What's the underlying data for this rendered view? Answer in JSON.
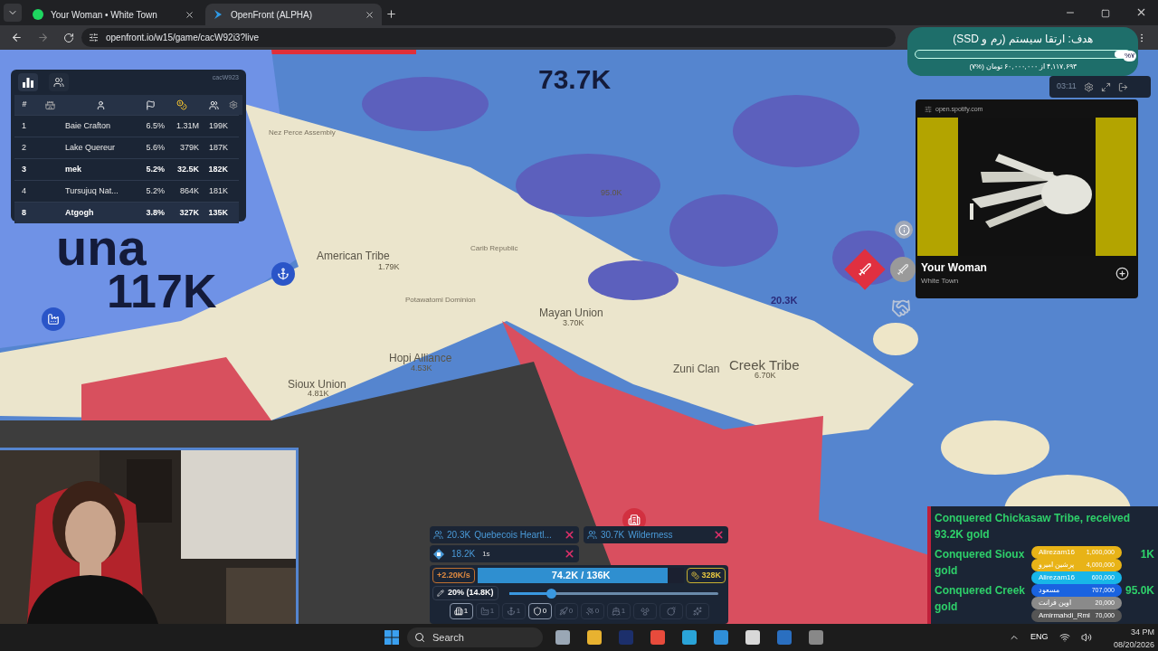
{
  "browser": {
    "tabs": [
      {
        "title": "Your Woman • White Town",
        "kind": "music",
        "selected": false
      },
      {
        "title": "OpenFront (ALPHA)",
        "kind": "game",
        "selected": true
      }
    ],
    "url": "openfront.io/w15/game/cacW92i3?live"
  },
  "leaderboard": {
    "game_id": "cacW923",
    "rank_header": "#",
    "rows": [
      {
        "rank": "1",
        "name": "Baie Crafton",
        "land": "6.5%",
        "gold": "1.31M",
        "troops": "199K",
        "highlighted": false
      },
      {
        "rank": "2",
        "name": "Lake Quereur",
        "land": "5.6%",
        "gold": "379K",
        "troops": "187K",
        "highlighted": false
      },
      {
        "rank": "3",
        "name": "mek",
        "land": "5.2%",
        "gold": "32.5K",
        "troops": "182K",
        "highlighted": true
      },
      {
        "rank": "4",
        "name": "Tursujuq Nat...",
        "land": "5.2%",
        "gold": "864K",
        "troops": "181K",
        "highlighted": false
      },
      {
        "rank": "8",
        "name": "Atgogh",
        "land": "3.8%",
        "gold": "327K",
        "troops": "135K",
        "highlighted": true
      }
    ]
  },
  "map": {
    "labels": [
      {
        "text": "73.7K",
        "kind": "power"
      },
      {
        "text": "una",
        "kind": "power"
      },
      {
        "text": "117K",
        "kind": "power"
      },
      {
        "text": "Nez Perce Assembly",
        "kind": "minor"
      },
      {
        "text": "American Tribe",
        "kind": "region"
      },
      {
        "text": "1.79K",
        "kind": "value"
      },
      {
        "text": "Carib Republic",
        "kind": "minor"
      },
      {
        "text": "Potawatomi Dominion",
        "kind": "minor"
      },
      {
        "text": "95.0K",
        "kind": "value"
      },
      {
        "text": "Mayan Union",
        "kind": "region"
      },
      {
        "text": "3.70K",
        "kind": "value"
      },
      {
        "text": "20.3K",
        "kind": "enemy"
      },
      {
        "text": "Hopi Alliance",
        "kind": "region"
      },
      {
        "text": "4.53K",
        "kind": "value"
      },
      {
        "text": "Sioux Union",
        "kind": "region"
      },
      {
        "text": "4.81K",
        "kind": "value"
      },
      {
        "text": "Zuni Clan",
        "kind": "region"
      },
      {
        "text": "Creek Tribe",
        "kind": "large"
      },
      {
        "text": "6.70K",
        "kind": "value"
      }
    ]
  },
  "goal": {
    "title": "هدف: ارتقا سیستم (رم و SSD)",
    "percent": "%۷",
    "level": 0.07,
    "summary": "۴,۱۱۷,۶۹۳ از ۶۰,۰۰۰,۰۰۰ تومان (%۷)"
  },
  "timer": "03:11",
  "now_playing": {
    "source": "open.spotify.com",
    "track": "Your Woman",
    "artist": "White Town"
  },
  "attacks": [
    {
      "troops": "20.3K",
      "target": "Quebecois Heartl..."
    },
    {
      "troops": "30.7K",
      "target": "Wilderness"
    }
  ],
  "boat": {
    "troops": "18.2K",
    "time": "1s"
  },
  "troop_bar": {
    "rate": "+2.20K/s",
    "text": "74.2K / 136K",
    "level": 0.92,
    "gold": "328K"
  },
  "attack_ratio": {
    "text": "20% (14.8K)",
    "level": 0.2
  },
  "builds": [
    {
      "kind": "city",
      "count": "1",
      "selected": true
    },
    {
      "kind": "factory",
      "count": "1",
      "selected": false
    },
    {
      "kind": "port",
      "count": "1",
      "selected": false
    },
    {
      "kind": "defense",
      "count": "0",
      "selected": true
    },
    {
      "kind": "missile",
      "count": "0",
      "selected": false
    },
    {
      "kind": "sam",
      "count": "0",
      "selected": false
    },
    {
      "kind": "warship",
      "count": "1",
      "selected": false
    },
    {
      "kind": "atom",
      "selected": false
    },
    {
      "kind": "hydrogen",
      "selected": false
    },
    {
      "kind": "mirv",
      "selected": false
    }
  ],
  "messages": [
    {
      "text": "Conquered Chickasaw Tribe, received 93.2K gold"
    },
    {
      "text": "Conquered Sioux",
      "tail": "1K",
      "end": "gold"
    },
    {
      "text": "Conquered Creek",
      "tail": "95.0K",
      "end": "gold"
    }
  ],
  "donors": [
    {
      "name": "Alirezam16",
      "amount": "1,000,000",
      "color": "#e8b317"
    },
    {
      "name": "پرشین امیرو",
      "amount": "4,000,000",
      "color": "#e8b317"
    },
    {
      "name": "Alirezam16",
      "amount": "600,000",
      "color": "#18b6e8"
    },
    {
      "name": "مسعود",
      "amount": "707,000",
      "color": "#1a63e0"
    },
    {
      "name": "اوین فرانت",
      "amount": "20,000",
      "color": "#8a8a8a"
    },
    {
      "name": "Amirmahdi_Rml",
      "amount": "70,000",
      "color": "#555555"
    }
  ],
  "taskbar": {
    "search": "Search",
    "language": "ENG",
    "time": "34 PM",
    "date": "08/20/2026"
  }
}
